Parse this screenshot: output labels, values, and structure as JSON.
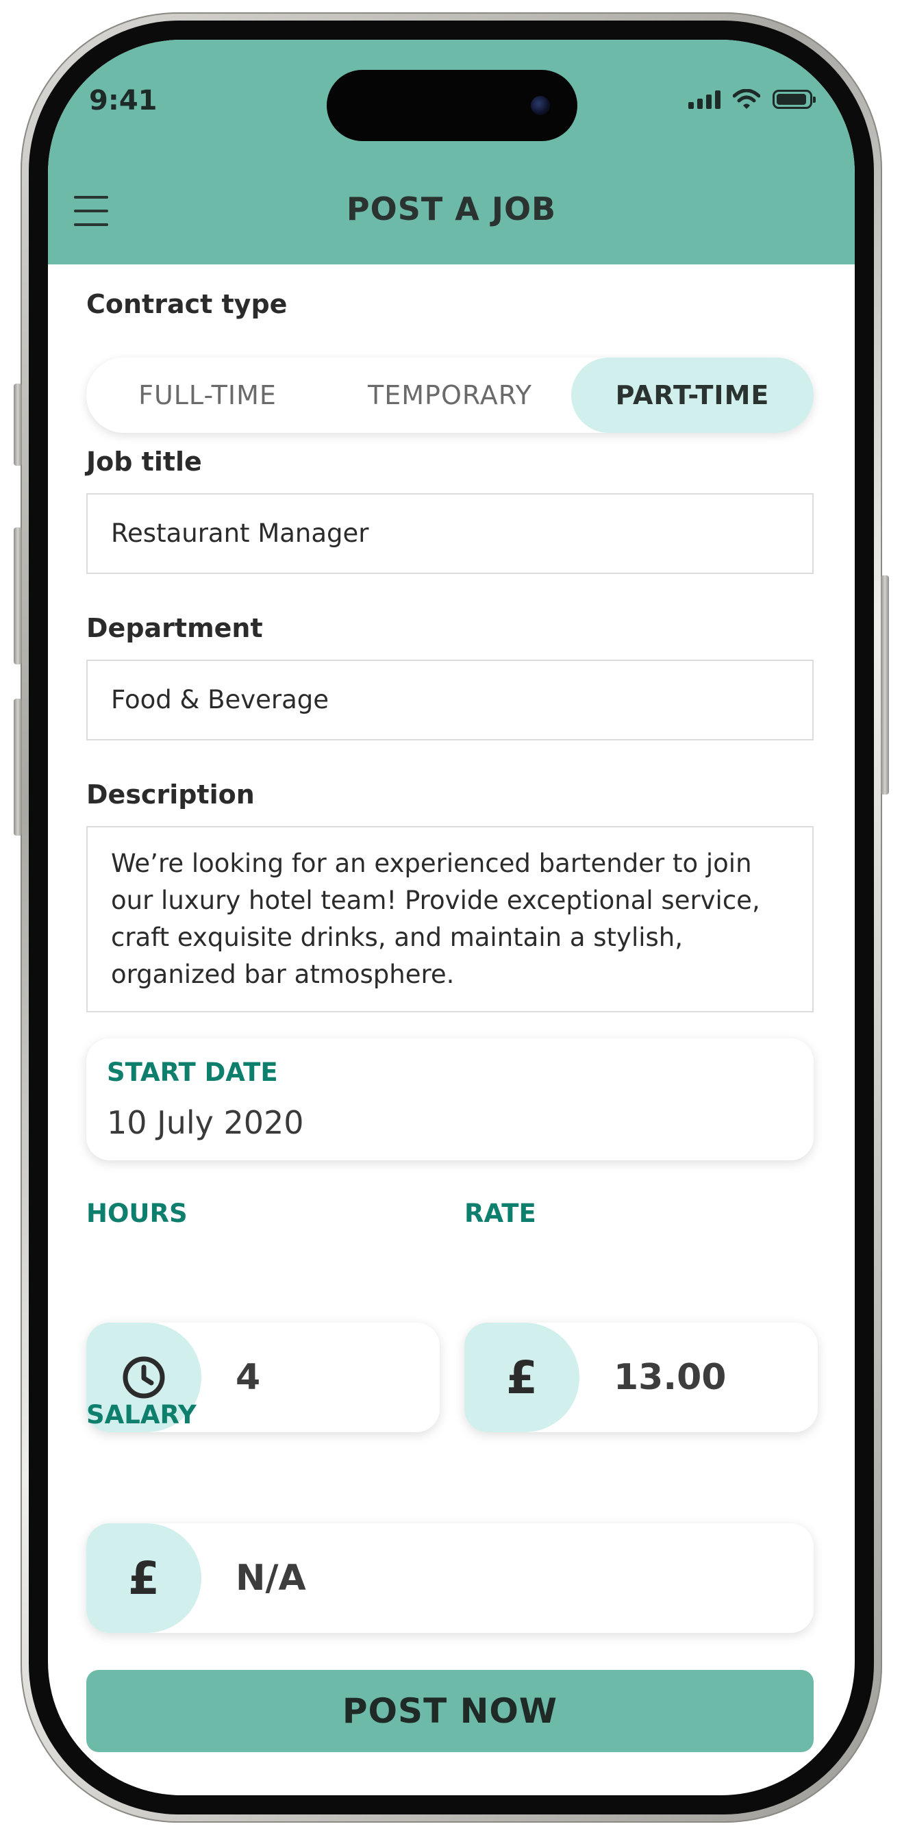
{
  "status_bar": {
    "time": "9:41"
  },
  "header": {
    "title": "POST A JOB",
    "menu_icon": "hamburger-menu-icon"
  },
  "contract": {
    "label": "Contract type",
    "options": [
      "FULL-TIME",
      "TEMPORARY",
      "PART-TIME"
    ],
    "selected": "PART-TIME"
  },
  "job_title": {
    "label": "Job title",
    "value": "Restaurant Manager"
  },
  "department": {
    "label": "Department",
    "value": "Food & Beverage"
  },
  "description": {
    "label": "Description",
    "value": "We’re looking for an experienced bartender to join our luxury hotel team! Provide exceptional service, craft exquisite drinks, and maintain a stylish, organized bar atmosphere."
  },
  "start_date": {
    "label": "START DATE",
    "value": "10 July 2020"
  },
  "hours": {
    "label": "HOURS",
    "value": "4",
    "icon": "clock-icon"
  },
  "rate": {
    "label": "RATE",
    "value": "13.00",
    "icon": "pound-icon"
  },
  "salary": {
    "label": "SALARY",
    "value": "N/A",
    "icon": "pound-icon"
  },
  "submit": {
    "label": "POST NOW"
  },
  "colors": {
    "header_bg": "#6cbaa7",
    "accent_text": "#0e7f6d",
    "active_pill": "#d1efec"
  }
}
